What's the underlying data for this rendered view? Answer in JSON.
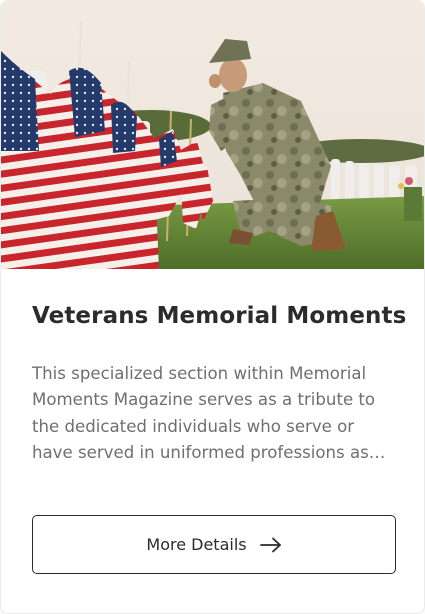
{
  "card": {
    "image_alt": "Soldier kneeling among American flags at a veterans cemetery",
    "title": "Veterans Memorial Moments",
    "description": "This specialized section within Memorial Moments Magazine serves as a tribute to the dedicated individuals who serve or have served in uniformed professions as veterans.",
    "button_label": "More Details",
    "button_icon": "arrow-right-icon"
  },
  "colors": {
    "title_text": "#2b2b2b",
    "body_text": "#6f6f6f",
    "button_border": "#2b2b2b"
  }
}
